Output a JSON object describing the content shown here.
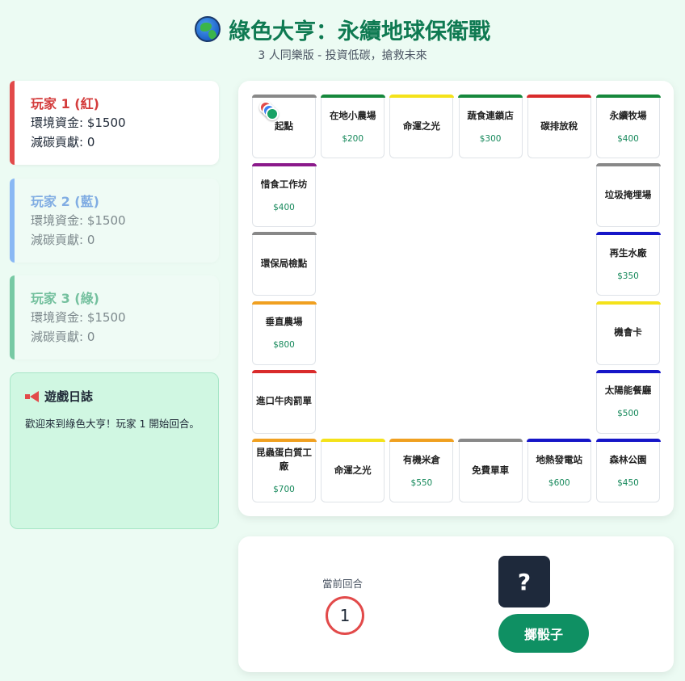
{
  "header": {
    "title": "綠色大亨：永續地球保衛戰",
    "subtitle": "3 人同樂版 - 投資低碳，搶救未來"
  },
  "players": [
    {
      "name": "玩家 1 (紅)",
      "funds": "環境資金: $1500",
      "reduction": "減碳貢獻: 0",
      "color": "#e24a4a"
    },
    {
      "name": "玩家 2 (藍)",
      "funds": "環境資金: $1500",
      "reduction": "減碳貢獻: 0",
      "color": "#3b82f6"
    },
    {
      "name": "玩家 3 (綠)",
      "funds": "環境資金: $1500",
      "reduction": "減碳貢獻: 0",
      "color": "#18a164"
    }
  ],
  "log": {
    "title": "遊戲日誌",
    "text": "歡迎來到綠色大亨！玩家 1 開始回合。"
  },
  "board": {
    "cells": [
      {
        "name": "起點",
        "price": "",
        "color": "#888888"
      },
      {
        "name": "在地小農場",
        "price": "$200",
        "color": "#16883c"
      },
      {
        "name": "命運之光",
        "price": "",
        "color": "#f4e21a"
      },
      {
        "name": "蔬食連鎖店",
        "price": "$300",
        "color": "#16883c"
      },
      {
        "name": "碳排放稅",
        "price": "",
        "color": "#d92b2b"
      },
      {
        "name": "永續牧場",
        "price": "$400",
        "color": "#16883c"
      },
      {
        "name": "垃圾掩埋場",
        "price": "",
        "color": "#888888"
      },
      {
        "name": "再生水廠",
        "price": "$350",
        "color": "#1616c8"
      },
      {
        "name": "機會卡",
        "price": "",
        "color": "#f4e21a"
      },
      {
        "name": "太陽能餐廳",
        "price": "$500",
        "color": "#1616c8"
      },
      {
        "name": "森林公園",
        "price": "$450",
        "color": "#1616c8"
      },
      {
        "name": "地熱發電站",
        "price": "$600",
        "color": "#1616c8"
      },
      {
        "name": "免費單車",
        "price": "",
        "color": "#888888"
      },
      {
        "name": "有機米倉",
        "price": "$550",
        "color": "#f0a020"
      },
      {
        "name": "命運之光",
        "price": "",
        "color": "#f4e21a"
      },
      {
        "name": "昆蟲蛋白質工廠",
        "price": "$700",
        "color": "#f0a020"
      },
      {
        "name": "進口牛肉罰單",
        "price": "",
        "color": "#d92b2b"
      },
      {
        "name": "垂直農場",
        "price": "$800",
        "color": "#f0a020"
      },
      {
        "name": "環保局檢點",
        "price": "",
        "color": "#888888"
      },
      {
        "name": "惜食工作坊",
        "price": "$400",
        "color": "#8b1a8b"
      }
    ]
  },
  "controls": {
    "round_label": "當前回合",
    "round_value": "1",
    "dice_face": "?",
    "roll_label": "擲骰子"
  }
}
